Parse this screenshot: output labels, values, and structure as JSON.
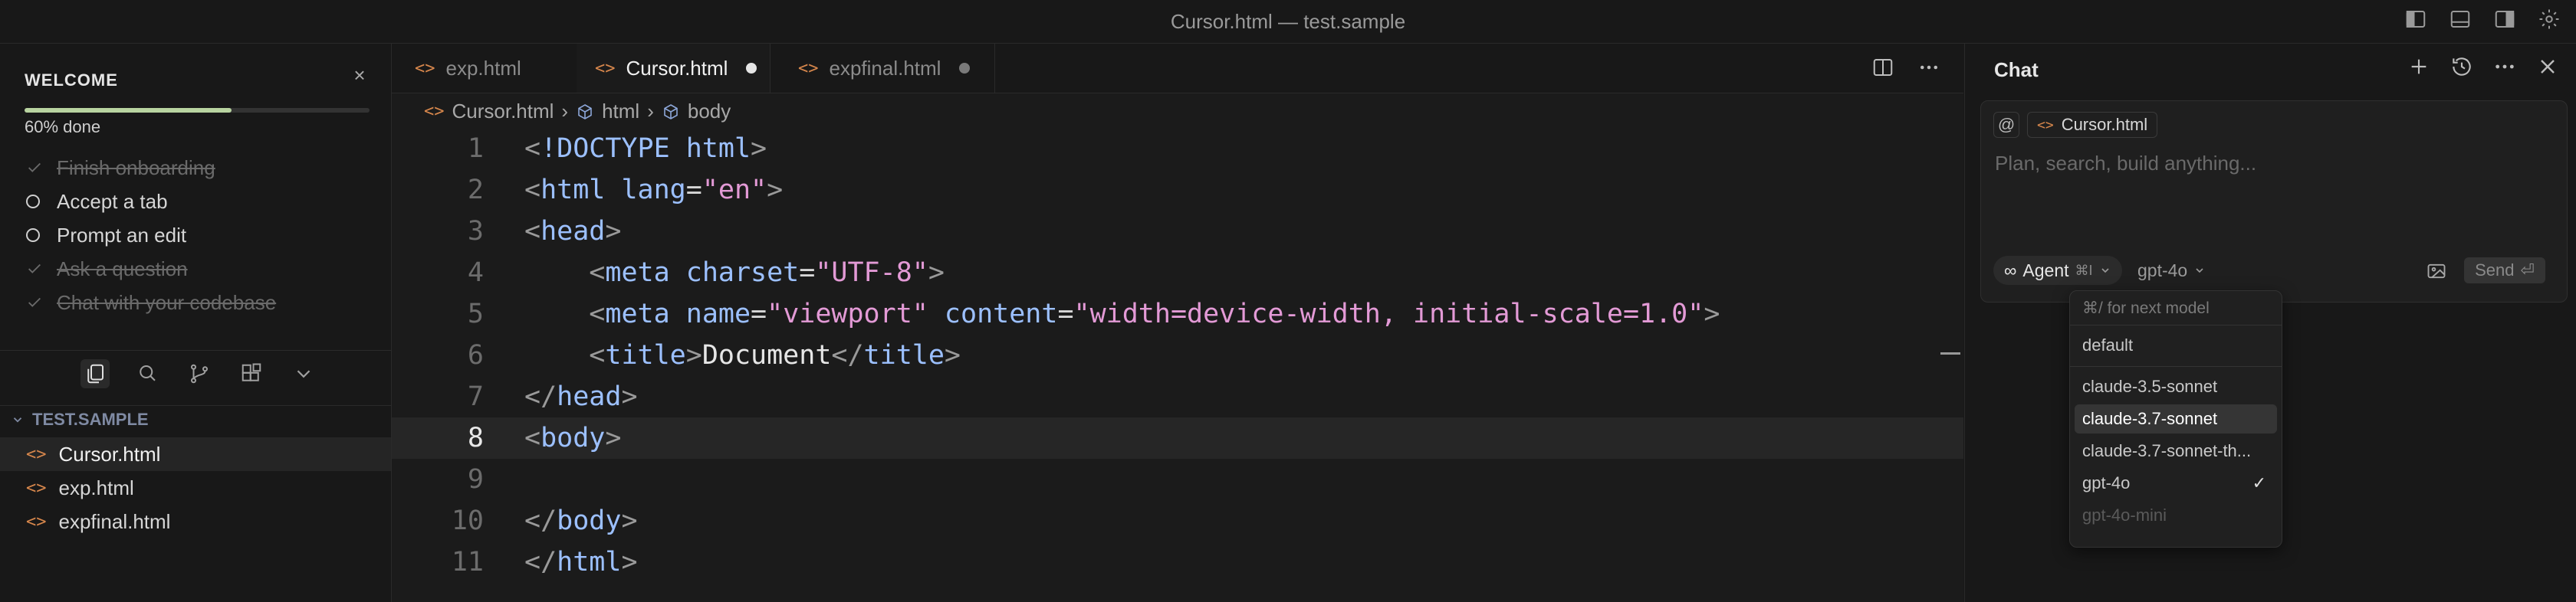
{
  "window": {
    "title": "Cursor.html — test.sample"
  },
  "sidebar": {
    "welcome": {
      "title": "WELCOME",
      "progress_label": "60% done",
      "progress_percent": 60,
      "items": [
        {
          "label": "Finish onboarding",
          "done": true
        },
        {
          "label": "Accept a tab",
          "done": false
        },
        {
          "label": "Prompt an edit",
          "done": false
        },
        {
          "label": "Ask a question",
          "done": true
        },
        {
          "label": "Chat with your codebase",
          "done": true
        }
      ]
    },
    "project": "TEST.SAMPLE",
    "files": [
      "Cursor.html",
      "exp.html",
      "expfinal.html"
    ],
    "active_file": "Cursor.html"
  },
  "editor": {
    "tabs": [
      {
        "label": "exp.html",
        "active": false
      },
      {
        "label": "Cursor.html",
        "active": true
      },
      {
        "label": "expfinal.html",
        "active": false
      }
    ],
    "breadcrumb": [
      "Cursor.html",
      "html",
      "body"
    ],
    "current_line": 8,
    "lines": [
      "1",
      "2",
      "3",
      "4",
      "5",
      "6",
      "7",
      "8",
      "9",
      "10",
      "11"
    ]
  },
  "chat": {
    "title": "Chat",
    "context_file": "Cursor.html",
    "at_symbol": "@",
    "placeholder": "Plan, search, build anything...",
    "mode": "Agent",
    "mode_shortcut": "⌘I",
    "model": "gpt-4o",
    "send_label": "Send",
    "dropdown": {
      "hint": "⌘/ for next model",
      "items": [
        {
          "label": "default"
        },
        {
          "label": "claude-3.5-sonnet"
        },
        {
          "label": "claude-3.7-sonnet"
        },
        {
          "label": "claude-3.7-sonnet-th..."
        },
        {
          "label": "gpt-4o"
        },
        {
          "label": "gpt-4o-mini"
        }
      ],
      "highlighted": "claude-3.7-sonnet",
      "selected": "gpt-4o"
    }
  },
  "colors": {
    "accent": "#d7874c",
    "tag": "#9cc0ff",
    "attr": "#9cc0ff",
    "string": "#e39ad6",
    "punct": "#9a9a9a",
    "progress": "#b8d3a0"
  }
}
